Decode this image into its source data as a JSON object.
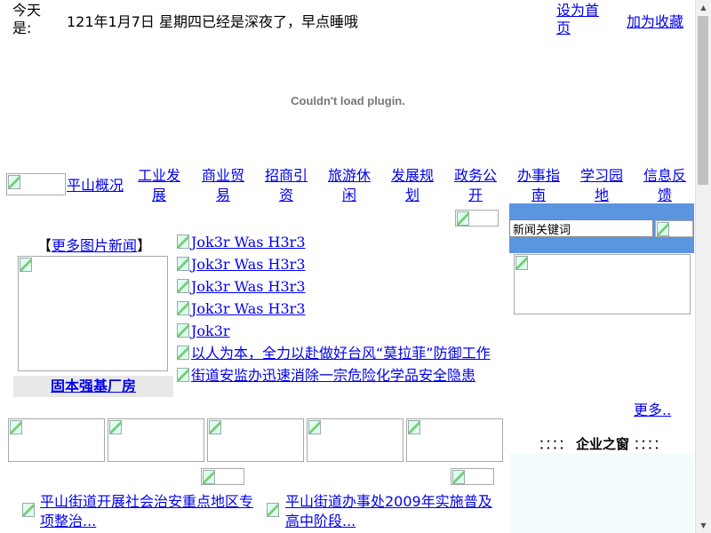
{
  "header": {
    "today_label": "今天是:",
    "date_text": "121年1月7日 星期四",
    "greeting": "已经是深夜了，早点睡哦",
    "set_home": "设为首页",
    "add_favorite": "加为收藏"
  },
  "plugin": {
    "message": "Couldn't load plugin."
  },
  "nav": {
    "items": [
      {
        "label": "平山概况"
      },
      {
        "label": "工业发展"
      },
      {
        "label": "商业贸易"
      },
      {
        "label": "招商引资"
      },
      {
        "label": "旅游休闲"
      },
      {
        "label": "发展规划"
      },
      {
        "label": "政务公开"
      },
      {
        "label": "办事指南"
      },
      {
        "label": "学习园地"
      },
      {
        "label": "信息反馈"
      }
    ]
  },
  "photo_news": {
    "more_label": "更多图片新闻",
    "bracket_open": "【",
    "bracket_close": "】",
    "caption": "固本强基厂房"
  },
  "news": {
    "items": [
      {
        "title": "Jok3r Was H3r3"
      },
      {
        "title": "Jok3r Was H3r3"
      },
      {
        "title": "Jok3r Was H3r3"
      },
      {
        "title": "Jok3r Was H3r3"
      },
      {
        "title": "Jok3r"
      },
      {
        "title": "以人为本，全力以赴做好台风“莫拉菲”防御工作"
      },
      {
        "title": "街道安监办迅速消除一宗危险化学品安全隐患"
      }
    ],
    "more_label": "更多.."
  },
  "search": {
    "value": "新闻关键词"
  },
  "enterprise": {
    "title": "企业之窗",
    "dots_left": "：：：：",
    "dots_right": "：：：："
  },
  "bottom_news": {
    "left": "平山街道开展社会治安重点地区专项整治...",
    "right": "平山街道办事处2009年实施普及高中阶段..."
  },
  "colors": {
    "search_panel": "#5b95e0",
    "caption_bg": "#e8e8e8",
    "enterprise_bg": "#f3fbfd",
    "link": "#0000ee"
  }
}
